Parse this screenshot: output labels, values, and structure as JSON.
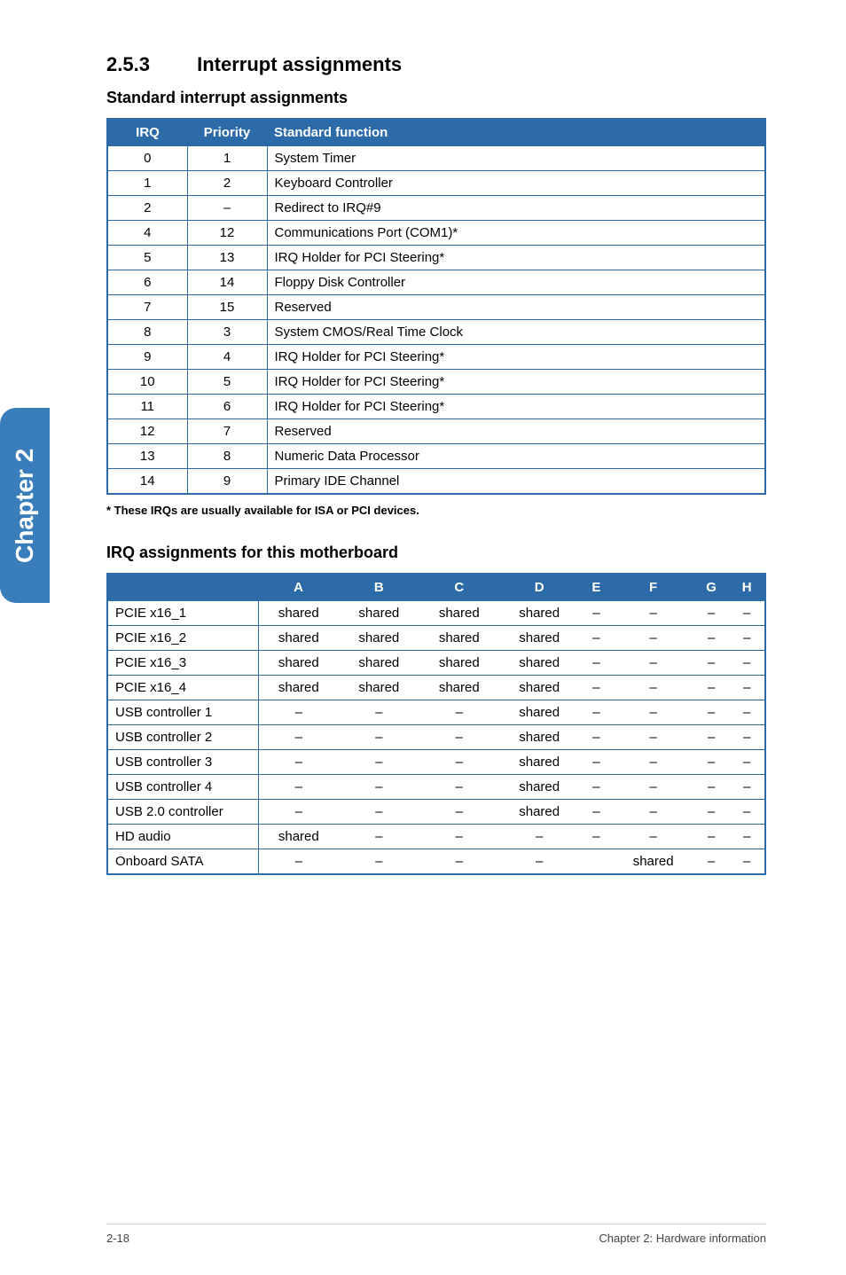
{
  "sidebar": {
    "label": "Chapter 2"
  },
  "section": {
    "number": "2.5.3",
    "title": "Interrupt assignments"
  },
  "table1": {
    "heading": "Standard interrupt assignments",
    "headers": {
      "irq": "IRQ",
      "priority": "Priority",
      "func": "Standard function"
    },
    "rows": [
      {
        "irq": "0",
        "priority": "1",
        "func": "System Timer"
      },
      {
        "irq": "1",
        "priority": "2",
        "func": "Keyboard Controller"
      },
      {
        "irq": "2",
        "priority": "–",
        "func": "Redirect to IRQ#9"
      },
      {
        "irq": "4",
        "priority": "12",
        "func": "Communications Port (COM1)*"
      },
      {
        "irq": "5",
        "priority": "13",
        "func": "IRQ Holder for PCI Steering*"
      },
      {
        "irq": "6",
        "priority": "14",
        "func": "Floppy Disk Controller"
      },
      {
        "irq": "7",
        "priority": "15",
        "func": "Reserved"
      },
      {
        "irq": "8",
        "priority": "3",
        "func": "System CMOS/Real Time Clock"
      },
      {
        "irq": "9",
        "priority": "4",
        "func": "IRQ Holder for PCI Steering*"
      },
      {
        "irq": "10",
        "priority": "5",
        "func": "IRQ Holder for PCI Steering*"
      },
      {
        "irq": "11",
        "priority": "6",
        "func": "IRQ Holder for PCI Steering*"
      },
      {
        "irq": "12",
        "priority": "7",
        "func": "Reserved"
      },
      {
        "irq": "13",
        "priority": "8",
        "func": "Numeric Data Processor"
      },
      {
        "irq": "14",
        "priority": "9",
        "func": "Primary IDE Channel"
      }
    ],
    "footnote": "* These IRQs are usually available for ISA or PCI devices."
  },
  "table2": {
    "heading": "IRQ assignments for this motherboard",
    "cols": [
      "A",
      "B",
      "C",
      "D",
      "E",
      "F",
      "G",
      "H"
    ],
    "rows": [
      {
        "label": "PCIE x16_1",
        "cells": [
          "shared",
          "shared",
          "shared",
          "shared",
          "–",
          "–",
          "–",
          "–"
        ]
      },
      {
        "label": "PCIE x16_2",
        "cells": [
          "shared",
          "shared",
          "shared",
          "shared",
          "–",
          "–",
          "–",
          "–"
        ]
      },
      {
        "label": "PCIE x16_3",
        "cells": [
          "shared",
          "shared",
          "shared",
          "shared",
          "–",
          "–",
          "–",
          "–"
        ]
      },
      {
        "label": "PCIE x16_4",
        "cells": [
          "shared",
          "shared",
          "shared",
          "shared",
          "–",
          "–",
          "–",
          "–"
        ]
      },
      {
        "label": "USB controller 1",
        "cells": [
          "–",
          "–",
          "–",
          "shared",
          "–",
          "–",
          "–",
          "–"
        ]
      },
      {
        "label": "USB controller 2",
        "cells": [
          "–",
          "–",
          "–",
          "shared",
          "–",
          "–",
          "–",
          "–"
        ]
      },
      {
        "label": "USB controller 3",
        "cells": [
          "–",
          "–",
          "–",
          "shared",
          "–",
          "–",
          "–",
          "–"
        ]
      },
      {
        "label": "USB controller 4",
        "cells": [
          "–",
          "–",
          "–",
          "shared",
          "–",
          "–",
          "–",
          "–"
        ]
      },
      {
        "label": "USB 2.0 controller",
        "cells": [
          "–",
          "–",
          "–",
          "shared",
          "–",
          "–",
          "–",
          "–"
        ]
      },
      {
        "label": "HD audio",
        "cells": [
          "shared",
          "–",
          "–",
          "–",
          "–",
          "–",
          "–",
          "–"
        ]
      },
      {
        "label": "Onboard SATA",
        "cells": [
          "–",
          "–",
          "–",
          "–",
          "",
          "shared",
          "–",
          "–"
        ]
      }
    ]
  },
  "footer": {
    "left": "2-18",
    "right": "Chapter 2: Hardware information"
  }
}
